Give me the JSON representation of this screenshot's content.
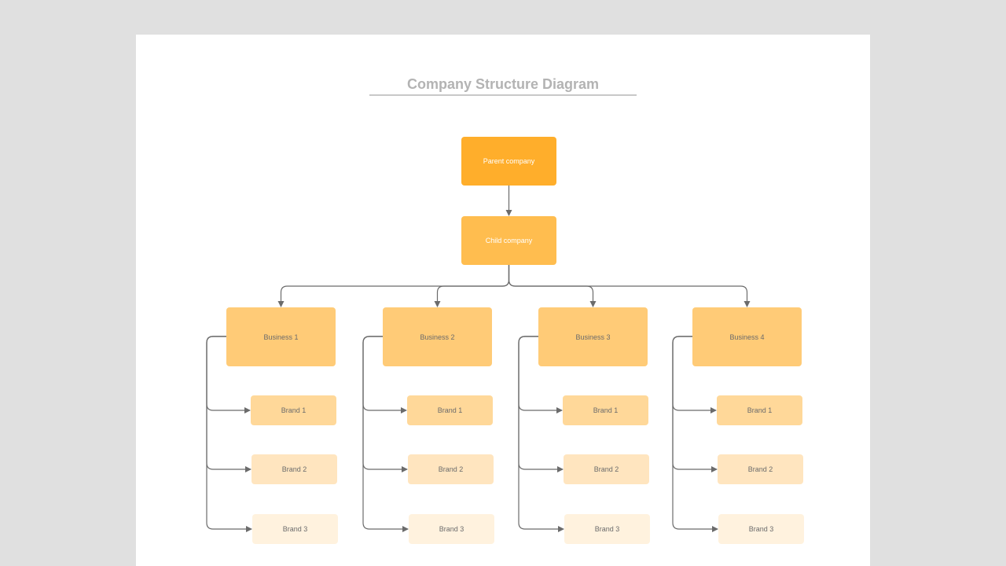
{
  "title": "Company Structure Diagram",
  "colors": {
    "parent": "#ffae2b",
    "child": "#ffbd4f",
    "business": "#ffcb77",
    "brand1": "#ffd899",
    "brand2": "#ffe5bf",
    "brand3": "#fff2de",
    "connector": "#6b6b6b"
  },
  "parent": {
    "label": "Parent company"
  },
  "child": {
    "label": "Child company"
  },
  "businesses": [
    {
      "label": "Business 1",
      "brands": [
        "Brand 1",
        "Brand 2",
        "Brand 3"
      ]
    },
    {
      "label": "Business 2",
      "brands": [
        "Brand 1",
        "Brand 2",
        "Brand 3"
      ]
    },
    {
      "label": "Business 3",
      "brands": [
        "Brand 1",
        "Brand 2",
        "Brand 3"
      ]
    },
    {
      "label": "Business 4",
      "brands": [
        "Brand 1",
        "Brand 2",
        "Brand 3"
      ]
    }
  ]
}
